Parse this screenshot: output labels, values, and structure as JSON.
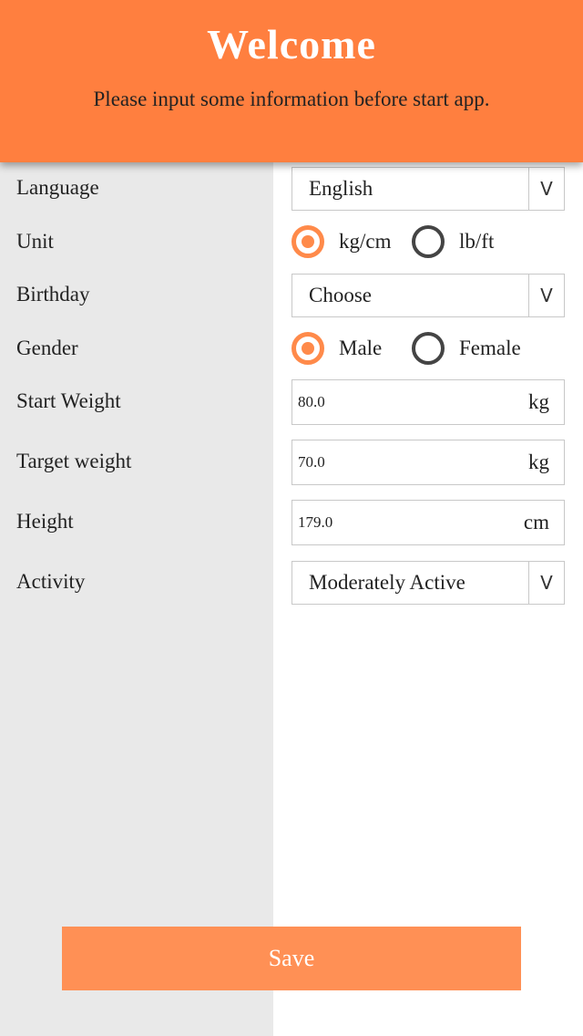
{
  "header": {
    "title": "Welcome",
    "subtitle": "Please input some information before start app."
  },
  "form": {
    "language": {
      "label": "Language",
      "value": "English",
      "chevron": "V"
    },
    "unit": {
      "label": "Unit",
      "options": [
        "kg/cm",
        "lb/ft"
      ],
      "selected": "kg/cm"
    },
    "birthday": {
      "label": "Birthday",
      "value": "Choose",
      "chevron": "V"
    },
    "gender": {
      "label": "Gender",
      "options": [
        "Male",
        "Female"
      ],
      "selected": "Male"
    },
    "start_weight": {
      "label": "Start Weight",
      "value": "80.0",
      "unit": "kg"
    },
    "target_weight": {
      "label": "Target weight",
      "value": "70.0",
      "unit": "kg"
    },
    "height": {
      "label": "Height",
      "value": "179.0",
      "unit": "cm"
    },
    "activity": {
      "label": "Activity",
      "value": "Moderately Active",
      "chevron": "V"
    }
  },
  "save_label": "Save",
  "colors": {
    "accent": "#ff7f3f",
    "radio_selected": "#ff8a4a",
    "left_panel": "#e9e9e9",
    "save_button": "#ff9055"
  }
}
